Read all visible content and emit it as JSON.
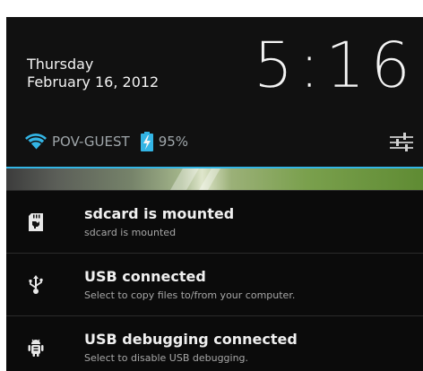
{
  "clock": {
    "day": "Thursday",
    "date": "February 16, 2012",
    "time": "5:16"
  },
  "status": {
    "wifi_name": "POV-GUEST",
    "battery": "95%"
  },
  "colors": {
    "accent": "#33b5e5",
    "background": "#0c0c0c",
    "text_primary": "#f0f0f0",
    "text_secondary": "#a7a7a7"
  },
  "notifications": [
    {
      "icon": "sdcard-icon",
      "title": "sdcard is mounted",
      "subtitle": "sdcard is mounted"
    },
    {
      "icon": "usb-icon",
      "title": "USB connected",
      "subtitle": "Select to copy files to/from your computer."
    },
    {
      "icon": "android-debug-icon",
      "title": "USB debugging connected",
      "subtitle": "Select to disable USB debugging."
    }
  ]
}
